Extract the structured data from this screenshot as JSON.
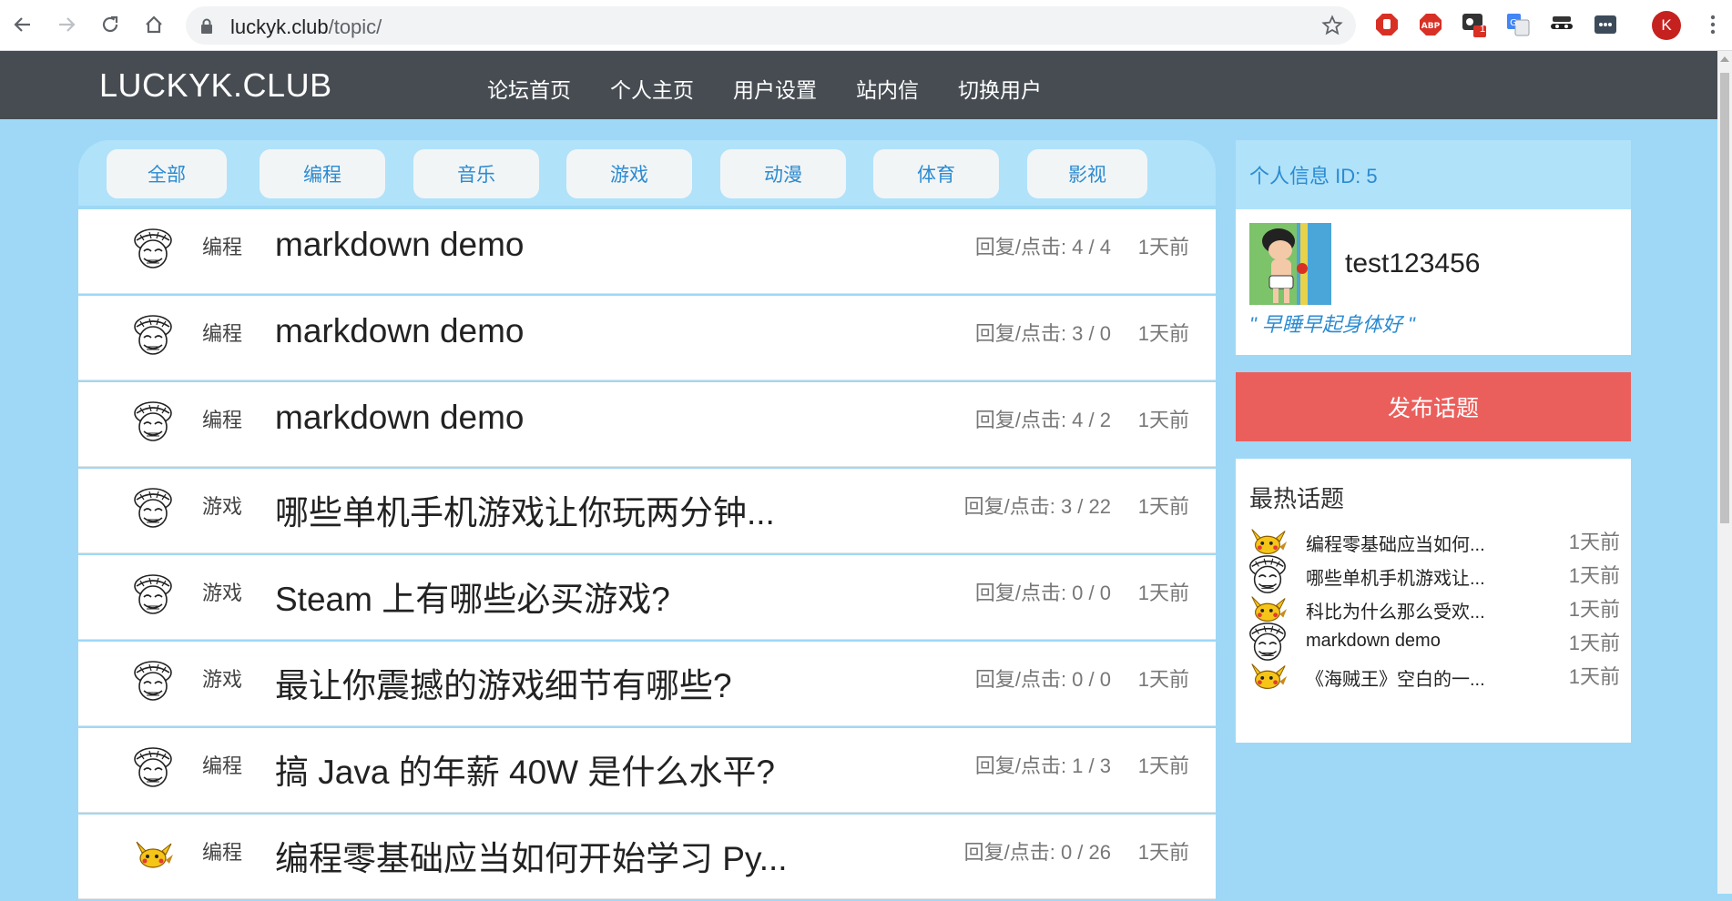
{
  "browser": {
    "url_host": "luckyk.club",
    "url_path": "/topic/",
    "profile_initial": "K",
    "extensions": [
      "stop-icon",
      "adblock-icon",
      "ext-badge-icon",
      "translate-icon",
      "spy-icon",
      "more-ext-icon"
    ],
    "ext_badge_count": "1"
  },
  "header": {
    "brand": "LUCKYK.CLUB",
    "nav": [
      "论坛首页",
      "个人主页",
      "用户设置",
      "站内信",
      "切换用户"
    ]
  },
  "categories": [
    "全部",
    "编程",
    "音乐",
    "游戏",
    "动漫",
    "体育",
    "影视"
  ],
  "topics": [
    {
      "tag": "编程",
      "title": "markdown demo",
      "stats": "回复/点击: 4 / 4",
      "time": "1天前",
      "avatar": "luffy"
    },
    {
      "tag": "编程",
      "title": "markdown demo",
      "stats": "回复/点击: 3 / 0",
      "time": "1天前",
      "avatar": "luffy"
    },
    {
      "tag": "编程",
      "title": "markdown demo",
      "stats": "回复/点击: 4 / 2",
      "time": "1天前",
      "avatar": "luffy"
    },
    {
      "tag": "游戏",
      "title": "哪些单机手机游戏让你玩两分钟...",
      "stats": "回复/点击: 3 / 22",
      "time": "1天前",
      "avatar": "luffy"
    },
    {
      "tag": "游戏",
      "title": "Steam 上有哪些必买游戏?",
      "stats": "回复/点击: 0 / 0",
      "time": "1天前",
      "avatar": "luffy"
    },
    {
      "tag": "游戏",
      "title": "最让你震撼的游戏细节有哪些?",
      "stats": "回复/点击: 0 / 0",
      "time": "1天前",
      "avatar": "luffy"
    },
    {
      "tag": "编程",
      "title": "搞 Java 的年薪 40W 是什么水平?",
      "stats": "回复/点击: 1 / 3",
      "time": "1天前",
      "avatar": "luffy"
    },
    {
      "tag": "编程",
      "title": "编程零基础应当如何开始学习 Py...",
      "stats": "回复/点击: 0 / 26",
      "time": "1天前",
      "avatar": "pikachu"
    }
  ],
  "profile": {
    "header": "个人信息 ID: 5",
    "username": "test123456",
    "motto": "\" 早睡早起身体好 \""
  },
  "post_button": "发布话题",
  "hot": {
    "title": "最热话题",
    "items": [
      {
        "text": "编程零基础应当如何...",
        "time": "1天前",
        "avatar": "pikachu"
      },
      {
        "text": "哪些单机手机游戏让...",
        "time": "1天前",
        "avatar": "luffy"
      },
      {
        "text": "科比为什么那么受欢...",
        "time": "1天前",
        "avatar": "pikachu"
      },
      {
        "text": "markdown demo",
        "time": "1天前",
        "avatar": "luffy"
      },
      {
        "text": "《海贼王》空白的一...",
        "time": "1天前",
        "avatar": "pikachu"
      }
    ]
  },
  "colors": {
    "page_bg": "#9ed8f6",
    "header_bg": "#464c52",
    "accent": "#2b8bd1",
    "post_button": "#ea5f5c"
  }
}
